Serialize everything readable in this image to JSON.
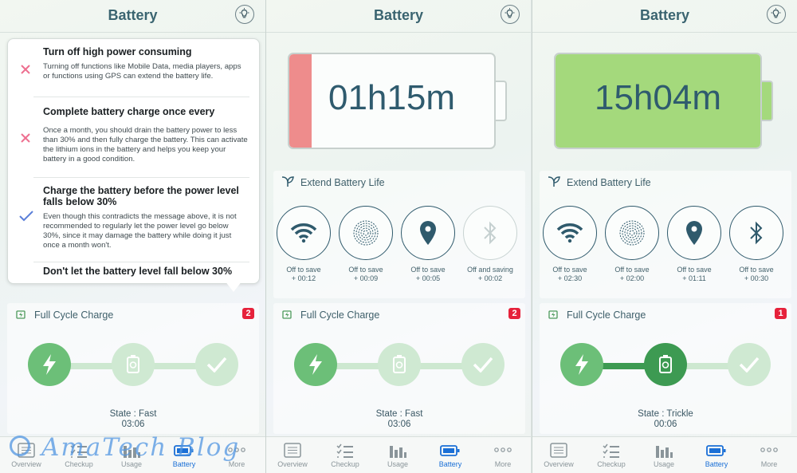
{
  "screens": [
    {
      "title": "Battery",
      "tips": [
        {
          "heading": "Turn off high power consuming",
          "body": "Turning off functions like Mobile Data, media players, apps or functions using GPS can extend the battery life.",
          "status": "cross"
        },
        {
          "heading": "Complete battery charge once every",
          "body": "Once a month, you should drain the battery power to less than 30% and then fully charge the battery. This can activate the lithium ions in the battery and helps you keep your battery in a good condition.",
          "status": "cross"
        },
        {
          "heading": "Charge the battery before the power level falls below 30%",
          "body": "Even though this contradicts the message above, it is not recommended to regularly let the power level go below 30%, since it may damage the battery while doing it just once a month won't.",
          "status": "check"
        },
        {
          "heading": "Don't let the battery level fall below 30%",
          "body": "",
          "status": "none"
        }
      ],
      "cycle": {
        "label": "Full Cycle Charge",
        "badge": "2",
        "state": "State : Fast",
        "time": "03:06",
        "active_stage": 1
      }
    },
    {
      "title": "Battery",
      "battery_time": "01h15m",
      "battery_level": 0.11,
      "extend": {
        "label": "Extend Battery Life",
        "features": [
          {
            "icon": "wifi-icon",
            "line1": "Off to save",
            "line2": "+ 00:12",
            "enabled": true
          },
          {
            "icon": "fingerprint-icon",
            "line1": "Off to save",
            "line2": "+ 00:09",
            "enabled": true
          },
          {
            "icon": "location-icon",
            "line1": "Off to save",
            "line2": "+ 00:05",
            "enabled": true
          },
          {
            "icon": "bluetooth-icon",
            "line1": "Off and saving",
            "line2": "+ 00:02",
            "enabled": false
          }
        ]
      },
      "cycle": {
        "label": "Full Cycle Charge",
        "badge": "2",
        "state": "State : Fast",
        "time": "03:06",
        "active_stage": 1
      }
    },
    {
      "title": "Battery",
      "battery_time": "15h04m",
      "battery_level": 1.0,
      "extend": {
        "label": "Extend Battery Life",
        "features": [
          {
            "icon": "wifi-icon",
            "line1": "Off to save",
            "line2": "+ 02:30",
            "enabled": true
          },
          {
            "icon": "fingerprint-icon",
            "line1": "Off to save",
            "line2": "+ 02:00",
            "enabled": true
          },
          {
            "icon": "location-icon",
            "line1": "Off to save",
            "line2": "+ 01:11",
            "enabled": true
          },
          {
            "icon": "bluetooth-icon",
            "line1": "Off to save",
            "line2": "+ 00:30",
            "enabled": true
          }
        ]
      },
      "cycle": {
        "label": "Full Cycle Charge",
        "badge": "1",
        "state": "State : Trickle",
        "time": "00:06",
        "active_stage": 2
      }
    }
  ],
  "tabs": [
    "Overview",
    "Checkup",
    "Usage",
    "Battery",
    "More"
  ],
  "active_tab": "Battery",
  "colors": {
    "low_battery": "#ee8c8c",
    "full_battery": "#a4d97c",
    "accent": "#2f5a6c",
    "stage_active": "#6cbf78",
    "stage_inactive": "#c9e8cc",
    "tab_active": "#1a6fd6"
  },
  "watermark": "AmaTech Blog"
}
